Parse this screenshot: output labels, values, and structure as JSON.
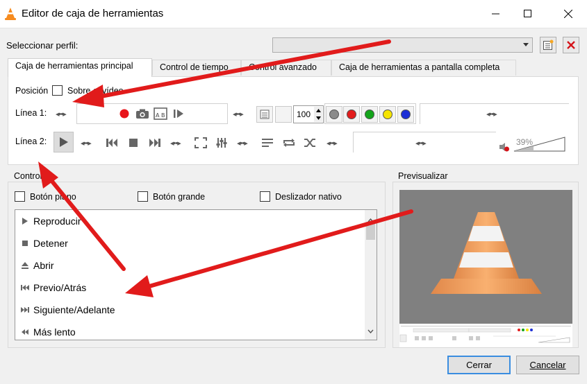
{
  "window": {
    "title": "Editor de caja de herramientas"
  },
  "profile": {
    "label": "Seleccionar perfil:",
    "value": ""
  },
  "tabs": [
    {
      "label": "Caja de herramientas principal"
    },
    {
      "label": "Control de tiempo"
    },
    {
      "label": "Control avanzado"
    },
    {
      "label": "Caja de herramientas a pantalla completa"
    }
  ],
  "position": {
    "label": "Posición",
    "checkbox_label": "Sobre el vídeo"
  },
  "line1": {
    "label": "Línea 1:",
    "spin_value": "100"
  },
  "line2": {
    "label": "Línea 2:",
    "volume": "39%"
  },
  "controls": {
    "title": "Controles",
    "options": [
      "Botón plano",
      "Botón grande",
      "Deslizador nativo"
    ],
    "items": [
      "Reproducir",
      "Detener",
      "Abrir",
      "Previo/Atrás",
      "Siguiente/Adelante",
      "Más lento"
    ]
  },
  "preview": {
    "title": "Previsualizar"
  },
  "buttons": {
    "close": "Cerrar",
    "cancel": "Cancelar"
  },
  "colors": {
    "accent": "#3a8de0",
    "arrow": "#e11b1b",
    "record": "#e8141a"
  }
}
